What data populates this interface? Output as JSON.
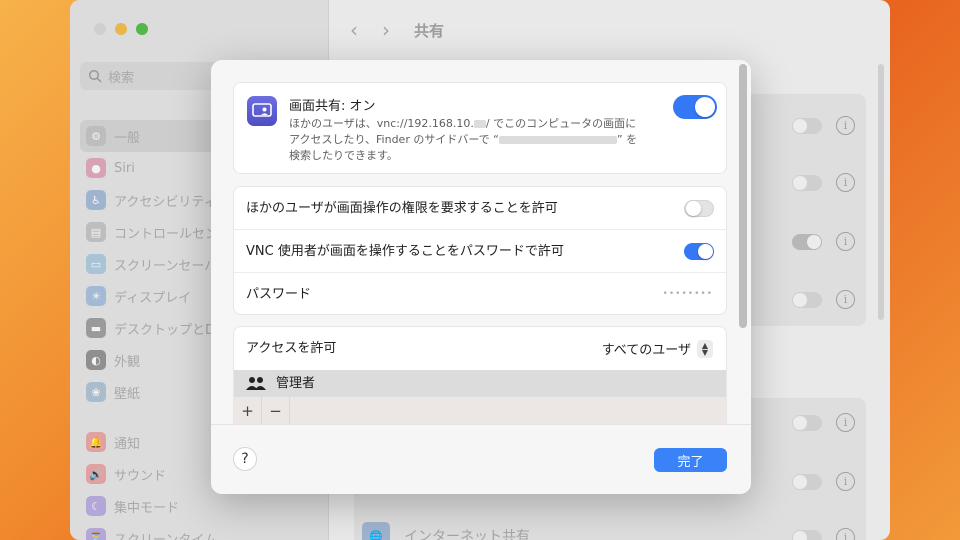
{
  "window": {
    "search_placeholder": "検索",
    "header_title": "共有",
    "sidebar_items": [
      {
        "label": "一般",
        "color": "#bdbdbd",
        "icon": "gear-icon",
        "glyph": "⚙",
        "selected": true
      },
      {
        "label": "Siri",
        "color": "#d7a2b6",
        "icon": "siri-icon",
        "glyph": "●"
      },
      {
        "label": "アクセシビリティ",
        "color": "#9fb4cf",
        "icon": "accessibility-icon",
        "glyph": "♿"
      },
      {
        "label": "コントロールセンター",
        "color": "#bdbdbd",
        "icon": "control-center-icon",
        "glyph": "▤"
      },
      {
        "label": "スクリーンセーバ",
        "color": "#a8c4d6",
        "icon": "screensaver-icon",
        "glyph": "▭"
      },
      {
        "label": "ディスプレイ",
        "color": "#a3bad6",
        "icon": "display-icon",
        "glyph": "☀"
      },
      {
        "label": "デスクトップとDock",
        "color": "#9a9a9a",
        "icon": "dock-icon",
        "glyph": "▬"
      },
      {
        "label": "外観",
        "color": "#8f8f8f",
        "icon": "appearance-icon",
        "glyph": "◐"
      },
      {
        "label": "壁紙",
        "color": "#a9bccc",
        "icon": "wallpaper-icon",
        "glyph": "❀"
      },
      {
        "label": "通知",
        "color": "#e2a1a1",
        "icon": "notification-icon",
        "glyph": "🔔"
      },
      {
        "label": "サウンド",
        "color": "#e2a1a1",
        "icon": "sound-icon",
        "glyph": "🔊"
      },
      {
        "label": "集中モード",
        "color": "#b3a7d9",
        "icon": "focus-icon",
        "glyph": "☾"
      },
      {
        "label": "スクリーンタイム",
        "color": "#b3a7d9",
        "icon": "screen-time-icon",
        "glyph": "⏳"
      }
    ],
    "internet_sharing_label": "インターネット共有"
  },
  "sheet": {
    "screen_sharing": {
      "title": "画面共有: オン",
      "desc_part1": "ほかのユーザは、vnc://192.168.10.",
      "desc_part2": "/ でこのコンピュータの画面に",
      "desc_line2a": "アクセスしたり、Finder のサイドバーで “",
      "desc_line2b": "” を",
      "desc_line3": "検索したりできます。",
      "enabled": true
    },
    "options": {
      "request_permission_label": "ほかのユーザが画面操作の権限を要求することを許可",
      "request_permission_on": false,
      "vnc_label": "VNC 使用者が画面を操作することをパスワードで許可",
      "vnc_on": true,
      "password_label": "パスワード",
      "password_mask": "••••••••"
    },
    "access": {
      "label": "アクセスを許可",
      "value": "すべてのユーザ",
      "users": [
        "管理者"
      ],
      "add_label": "+",
      "remove_label": "−"
    },
    "footer": {
      "help_label": "?",
      "done_label": "完了"
    }
  },
  "colors": {
    "accent": "#3478f6",
    "done_button": "#3a82f7"
  }
}
